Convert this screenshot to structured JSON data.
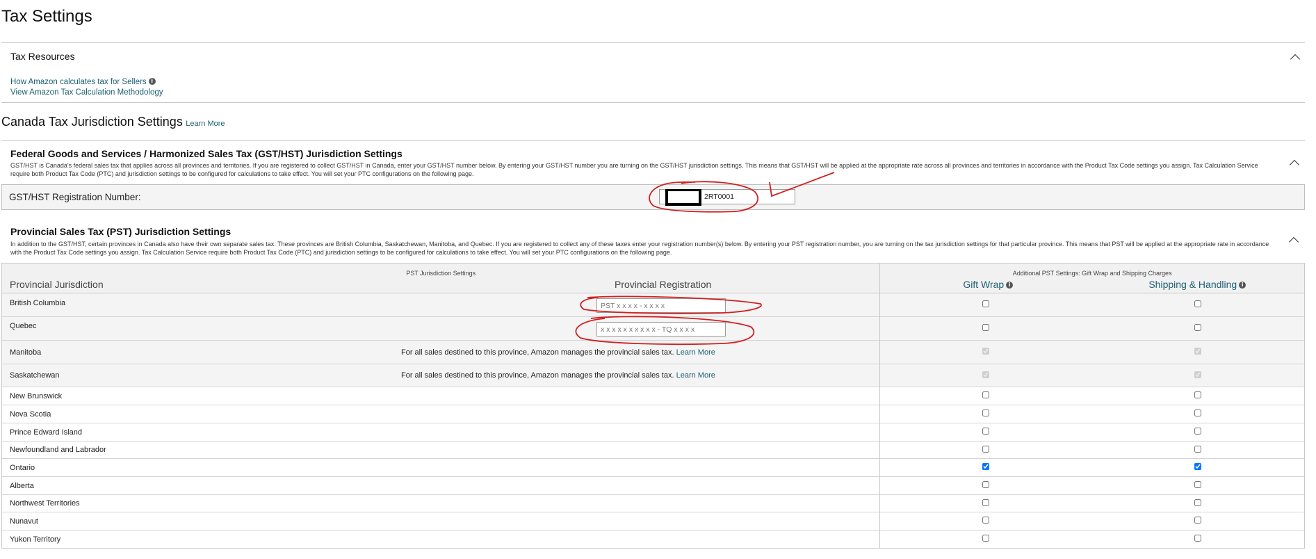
{
  "page": {
    "title": "Tax Settings"
  },
  "tax_resources": {
    "title": "Tax Resources",
    "links": [
      "How Amazon calculates tax for Sellers",
      "View Amazon Tax Calculation Methodology"
    ]
  },
  "canada": {
    "title": "Canada Tax Jurisdiction Settings",
    "learn_more": "Learn More"
  },
  "gst": {
    "title": "Federal Goods and Services / Harmonized Sales Tax (GST/HST) Jurisdiction Settings",
    "description": "GST/HST is Canada's federal sales tax that applies across all provinces and territories. If you are registered to collect GST/HST in Canada, enter your GST/HST number below. By entering your GST/HST number you are turning on the GST/HST jurisdiction settings. This means that GST/HST will be applied at the appropriate rate across all provinces and territories in accordance with the Product Tax Code settings you assign. Tax Calculation Service require both Product Tax Code (PTC) and jurisdiction settings to be configured for calculations to take effect. You will set your PTC configurations on the following page.",
    "field_label": "GST/HST Registration Number:",
    "field_value": "2RT0001"
  },
  "pst": {
    "title": "Provincial Sales Tax (PST) Jurisdiction Settings",
    "description": "In addition to the GST/HST, certain provinces in Canada also have their own separate sales tax. These provinces are British Columbia, Saskatchewan, Manitoba, and Quebec. If you are registered to collect any of these taxes enter your registration number(s) below. By entering your PST registration number, you are turning on the tax jurisdiction settings for that particular province. This means that PST will be applied at the appropriate rate in accordance with the Product Tax Code settings you assign. Tax Calculation Service require both Product Tax Code (PTC) and jurisdiction settings to be configured for calculations to take effect. You will set your PTC configurations on the following page.",
    "table": {
      "settings_caption": "PST Jurisdiction Settings",
      "col_jurisdiction": "Provincial Jurisdiction",
      "col_registration": "Provincial Registration",
      "additional_caption": "Additional PST Settings: Gift Wrap and Shipping Charges",
      "col_giftwrap": "Gift Wrap",
      "col_shipping": "Shipping & Handling",
      "managed_text": "For all sales destined to this province, Amazon manages the provincial sales tax.",
      "learn_more": "Learn More",
      "bc_placeholder": "PST x x x x - x x x x",
      "qc_placeholder": "x x x x x x x x x x - TQ x x x x",
      "rows": [
        {
          "name": "British Columbia"
        },
        {
          "name": "Quebec"
        },
        {
          "name": "Manitoba"
        },
        {
          "name": "Saskatchewan"
        },
        {
          "name": "New Brunswick"
        },
        {
          "name": "Nova Scotia"
        },
        {
          "name": "Prince Edward Island"
        },
        {
          "name": "Newfoundland and Labrador"
        },
        {
          "name": "Ontario"
        },
        {
          "name": "Alberta"
        },
        {
          "name": "Northwest Territories"
        },
        {
          "name": "Nunavut"
        },
        {
          "name": "Yukon Territory"
        }
      ]
    }
  }
}
